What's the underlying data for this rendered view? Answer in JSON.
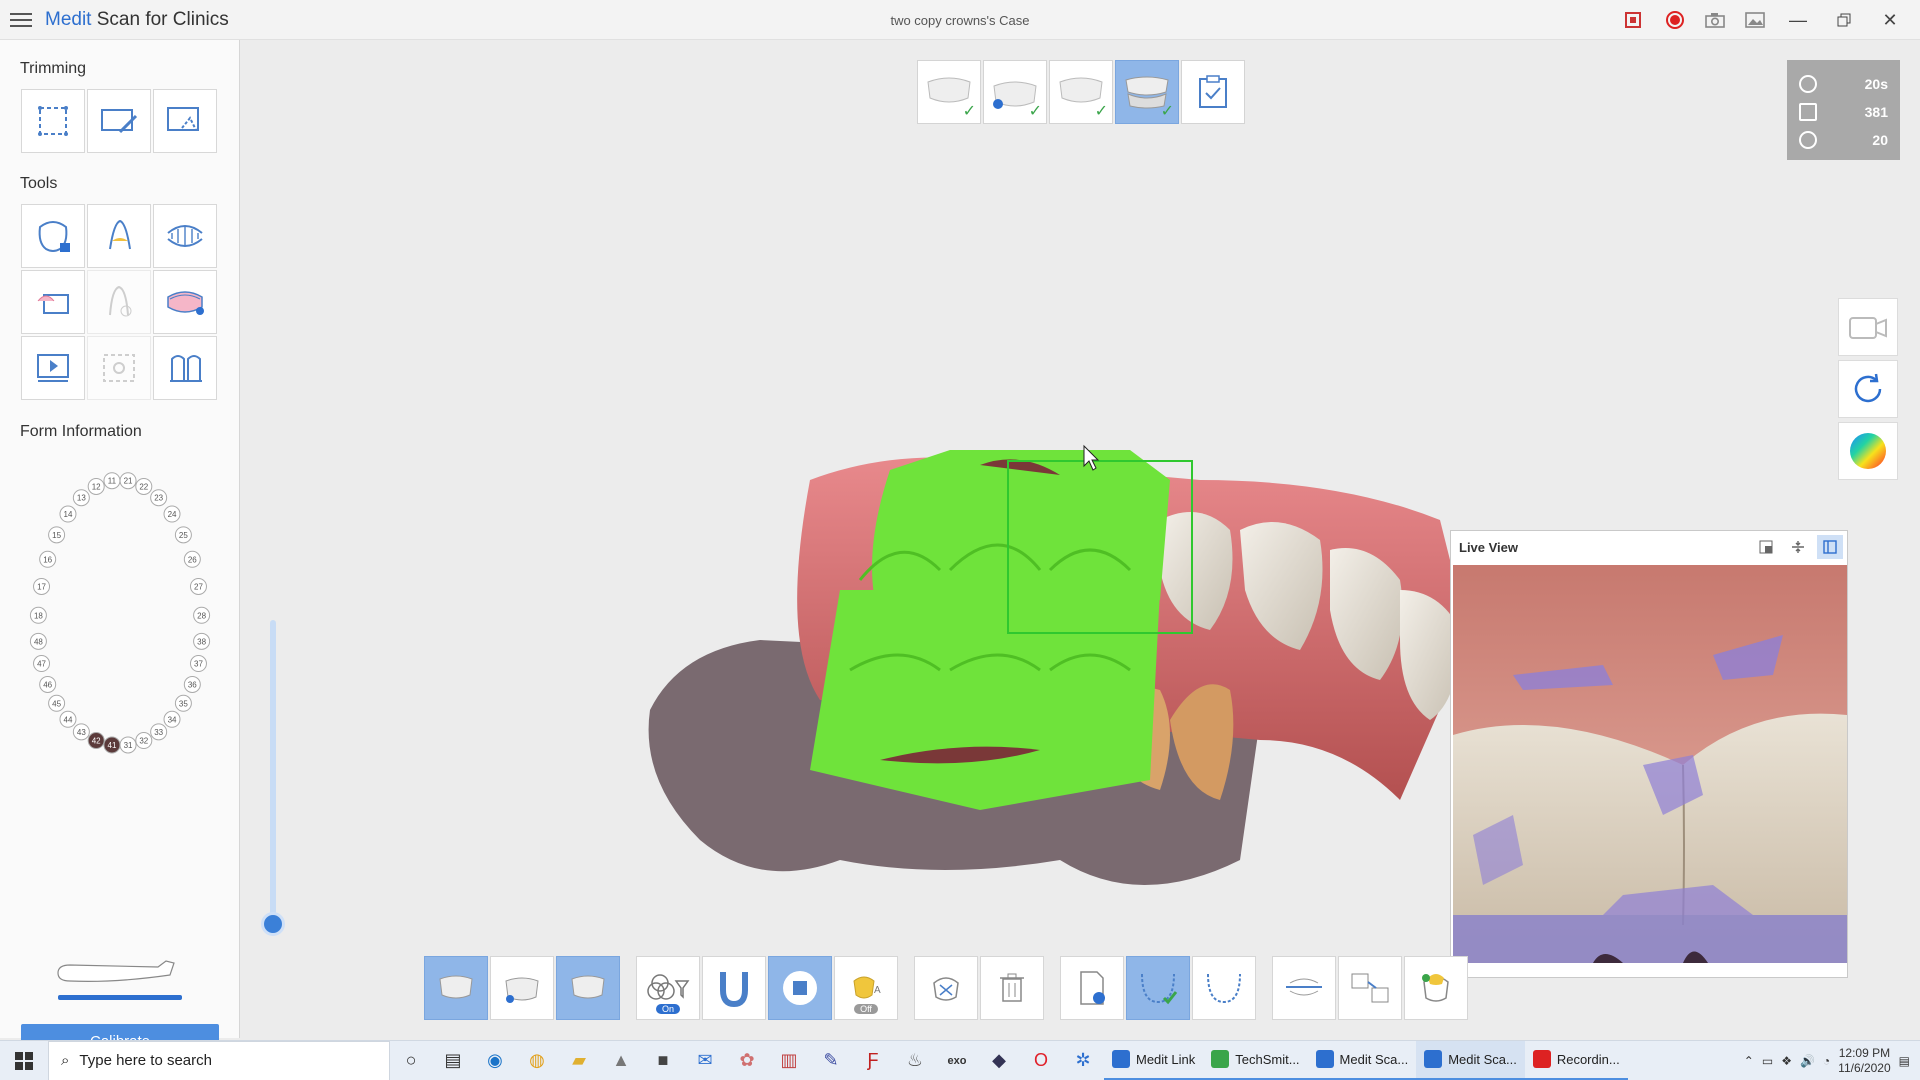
{
  "app": {
    "brand": "Medit",
    "title_rest": " Scan for Clinics",
    "case_title": "two copy crowns's Case"
  },
  "left": {
    "trimming_title": "Trimming",
    "tools_title": "Tools",
    "form_title": "Form Information",
    "calibrate_label": "Calibrate",
    "tooth_numbers_upper": [
      "11",
      "12",
      "13",
      "14",
      "15",
      "16",
      "17",
      "18",
      "21",
      "22",
      "23",
      "24",
      "25",
      "26",
      "27",
      "28"
    ],
    "tooth_numbers_lower": [
      "31",
      "32",
      "33",
      "34",
      "35",
      "36",
      "37",
      "38",
      "41",
      "42",
      "43",
      "44",
      "45",
      "46",
      "47",
      "48"
    ]
  },
  "stats": {
    "time": "20s",
    "frames": "381",
    "rate": "20"
  },
  "liveview": {
    "title": "Live View"
  },
  "taskbar": {
    "search_placeholder": "Type here to search",
    "apps": [
      "Medit Link",
      "TechSmit...",
      "Medit Sca...",
      "Medit Sca...",
      "Recordin..."
    ],
    "time": "12:09 PM",
    "date": "11/6/2020"
  },
  "colors": {
    "accent": "#4d8ee0",
    "scan_green": "#6fe33b",
    "active_tile": "#8fb6e8"
  }
}
